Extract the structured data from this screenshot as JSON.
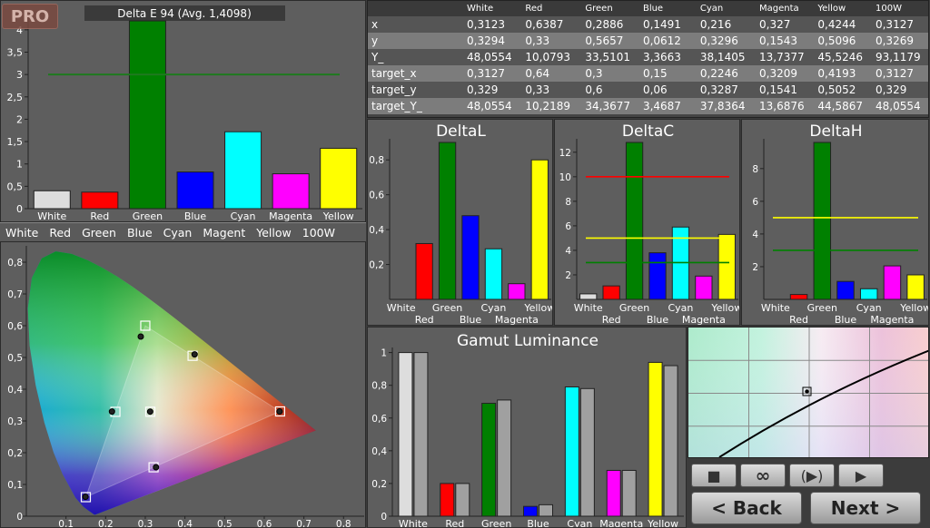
{
  "logo": "PRO",
  "deltaE": {
    "title": "Delta E 94 (Avg. 1,4098)",
    "yticks": [
      "0",
      "0,5",
      "1",
      "1,5",
      "2",
      "2,5",
      "3",
      "3,5",
      "4"
    ],
    "categories": [
      "White",
      "Red",
      "Green",
      "Blue",
      "Cyan",
      "Magenta",
      "Yellow"
    ],
    "colors": [
      "#dddddd",
      "#ff0000",
      "#008000",
      "#0000ff",
      "#00ffff",
      "#ff00ff",
      "#ffff00"
    ]
  },
  "patch_nav": [
    "White",
    "Red",
    "Green",
    "Blue",
    "Cyan",
    "Magent",
    "Yellow",
    "100W"
  ],
  "table": {
    "headers": [
      "",
      "White",
      "Red",
      "Green",
      "Blue",
      "Cyan",
      "Magenta",
      "Yellow",
      "100W"
    ],
    "rows": [
      [
        "x",
        "0,3123",
        "0,6387",
        "0,2886",
        "0,1491",
        "0,216",
        "0,327",
        "0,4244",
        "0,3127"
      ],
      [
        "y",
        "0,3294",
        "0,33",
        "0,5657",
        "0,0612",
        "0,3296",
        "0,1543",
        "0,5096",
        "0,3269"
      ],
      [
        "Y_",
        "48,0554",
        "10,0793",
        "33,5101",
        "3,3663",
        "38,1405",
        "13,7377",
        "45,5246",
        "93,1179"
      ],
      [
        "target_x",
        "0,3127",
        "0,64",
        "0,3",
        "0,15",
        "0,2246",
        "0,3209",
        "0,4193",
        "0,3127"
      ],
      [
        "target_y",
        "0,329",
        "0,33",
        "0,6",
        "0,06",
        "0,3287",
        "0,1541",
        "0,5052",
        "0,329"
      ],
      [
        "target_Y_",
        "48,0554",
        "10,2189",
        "34,3677",
        "3,4687",
        "37,8364",
        "13,6876",
        "44,5867",
        "48,0554"
      ]
    ]
  },
  "cie": {
    "xticks": [
      "0,1",
      "0,2",
      "0,3",
      "0,4",
      "0,5",
      "0,6",
      "0,7",
      "0,8"
    ],
    "yticks": [
      "0",
      "0,1",
      "0,2",
      "0,3",
      "0,4",
      "0,5",
      "0,6",
      "0,7",
      "0,8"
    ],
    "targets": [
      [
        0.3127,
        0.329
      ],
      [
        0.64,
        0.33
      ],
      [
        0.3,
        0.6
      ],
      [
        0.15,
        0.06
      ],
      [
        0.2246,
        0.3287
      ],
      [
        0.3209,
        0.1541
      ],
      [
        0.4193,
        0.5052
      ]
    ],
    "measured": [
      [
        0.3123,
        0.3294
      ],
      [
        0.6387,
        0.33
      ],
      [
        0.2886,
        0.5657
      ],
      [
        0.1491,
        0.0612
      ],
      [
        0.216,
        0.3296
      ],
      [
        0.327,
        0.1543
      ],
      [
        0.4244,
        0.5096
      ]
    ]
  },
  "chart_data": [
    {
      "type": "bar",
      "title": "Delta E 94 (Avg. 1,4098)",
      "categories": [
        "White",
        "Red",
        "Green",
        "Blue",
        "Cyan",
        "Magenta",
        "Yellow"
      ],
      "values": [
        0.4,
        0.37,
        4.2,
        0.82,
        1.72,
        0.78,
        1.35
      ],
      "ylim": [
        0,
        4.2
      ],
      "threshold": 3.0
    },
    {
      "type": "bar",
      "title": "DeltaL",
      "categories": [
        "White",
        "Red",
        "Green",
        "Blue",
        "Cyan",
        "Magenta",
        "Yellow"
      ],
      "values": [
        0.0,
        0.32,
        0.9,
        0.48,
        0.29,
        0.09,
        0.8
      ],
      "ylim": [
        0,
        0.9
      ]
    },
    {
      "type": "bar",
      "title": "DeltaC",
      "categories": [
        "White",
        "Red",
        "Green",
        "Blue",
        "Cyan",
        "Magenta",
        "Yellow"
      ],
      "values": [
        0.45,
        1.1,
        13.0,
        3.8,
        5.9,
        1.9,
        5.3
      ],
      "ylim": [
        0,
        12.8
      ],
      "thresholds": [
        {
          "value": 10,
          "color": "#ff0000"
        },
        {
          "value": 5,
          "color": "#ffff00"
        },
        {
          "value": 3,
          "color": "#008000"
        }
      ]
    },
    {
      "type": "bar",
      "title": "DeltaH",
      "categories": [
        "White",
        "Red",
        "Green",
        "Blue",
        "Cyan",
        "Magenta",
        "Yellow"
      ],
      "values": [
        0.0,
        0.3,
        9.6,
        1.1,
        0.65,
        2.05,
        1.5
      ],
      "ylim": [
        0,
        9.6
      ],
      "thresholds": [
        {
          "value": 5,
          "color": "#ffff00"
        },
        {
          "value": 3,
          "color": "#008000"
        }
      ]
    },
    {
      "type": "bar",
      "title": "Gamut Luminance",
      "categories": [
        "White",
        "Red",
        "Green",
        "Blue",
        "Cyan",
        "Magenta",
        "Yellow"
      ],
      "series": [
        {
          "values": [
            1.0,
            0.2,
            0.69,
            0.06,
            0.79,
            0.28,
            0.94
          ]
        },
        {
          "values": [
            1.0,
            0.2,
            0.71,
            0.07,
            0.78,
            0.28,
            0.92
          ]
        }
      ],
      "ylim": [
        0,
        1.02
      ]
    }
  ],
  "delta_labels": {
    "row1": [
      "White",
      "Green",
      "Cyan",
      "Yellow"
    ],
    "row2": [
      "Red",
      "Blue",
      "Magenta"
    ]
  },
  "controls": {
    "stop": "■",
    "loop": "∞",
    "play_pause": "(▶)",
    "play": "▶",
    "back": "< Back",
    "next": "Next >"
  }
}
